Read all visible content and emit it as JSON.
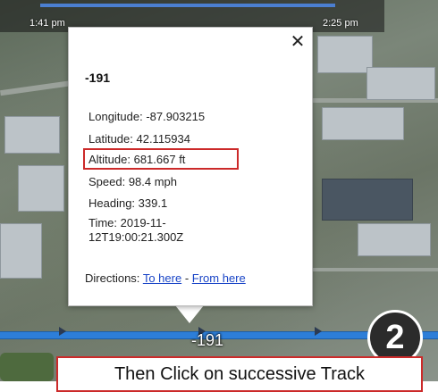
{
  "timeline": {
    "start_time": "1:41 pm",
    "end_time": "2:25 pm"
  },
  "popup": {
    "title": "-191",
    "close_icon": "✕",
    "longitude": "Longitude: -87.903215",
    "latitude": "Latitude: 42.115934",
    "altitude": "Altitude: 681.667 ft",
    "speed": "Speed: 98.4 mph",
    "heading": "Heading: 339.1",
    "time_line1": "Time: 2019-11-",
    "time_line2": "12T19:00:21.300Z",
    "directions_label": "Directions:",
    "to_here": "To here",
    "separator": "-",
    "from_here": "From here"
  },
  "track": {
    "label": "-191"
  },
  "step": {
    "number": "2"
  },
  "instruction": {
    "text": "Then Click on successive Track"
  },
  "colors": {
    "highlight": "#cc2a2a",
    "track": "#2d7ed8",
    "link": "#1a45c7"
  }
}
